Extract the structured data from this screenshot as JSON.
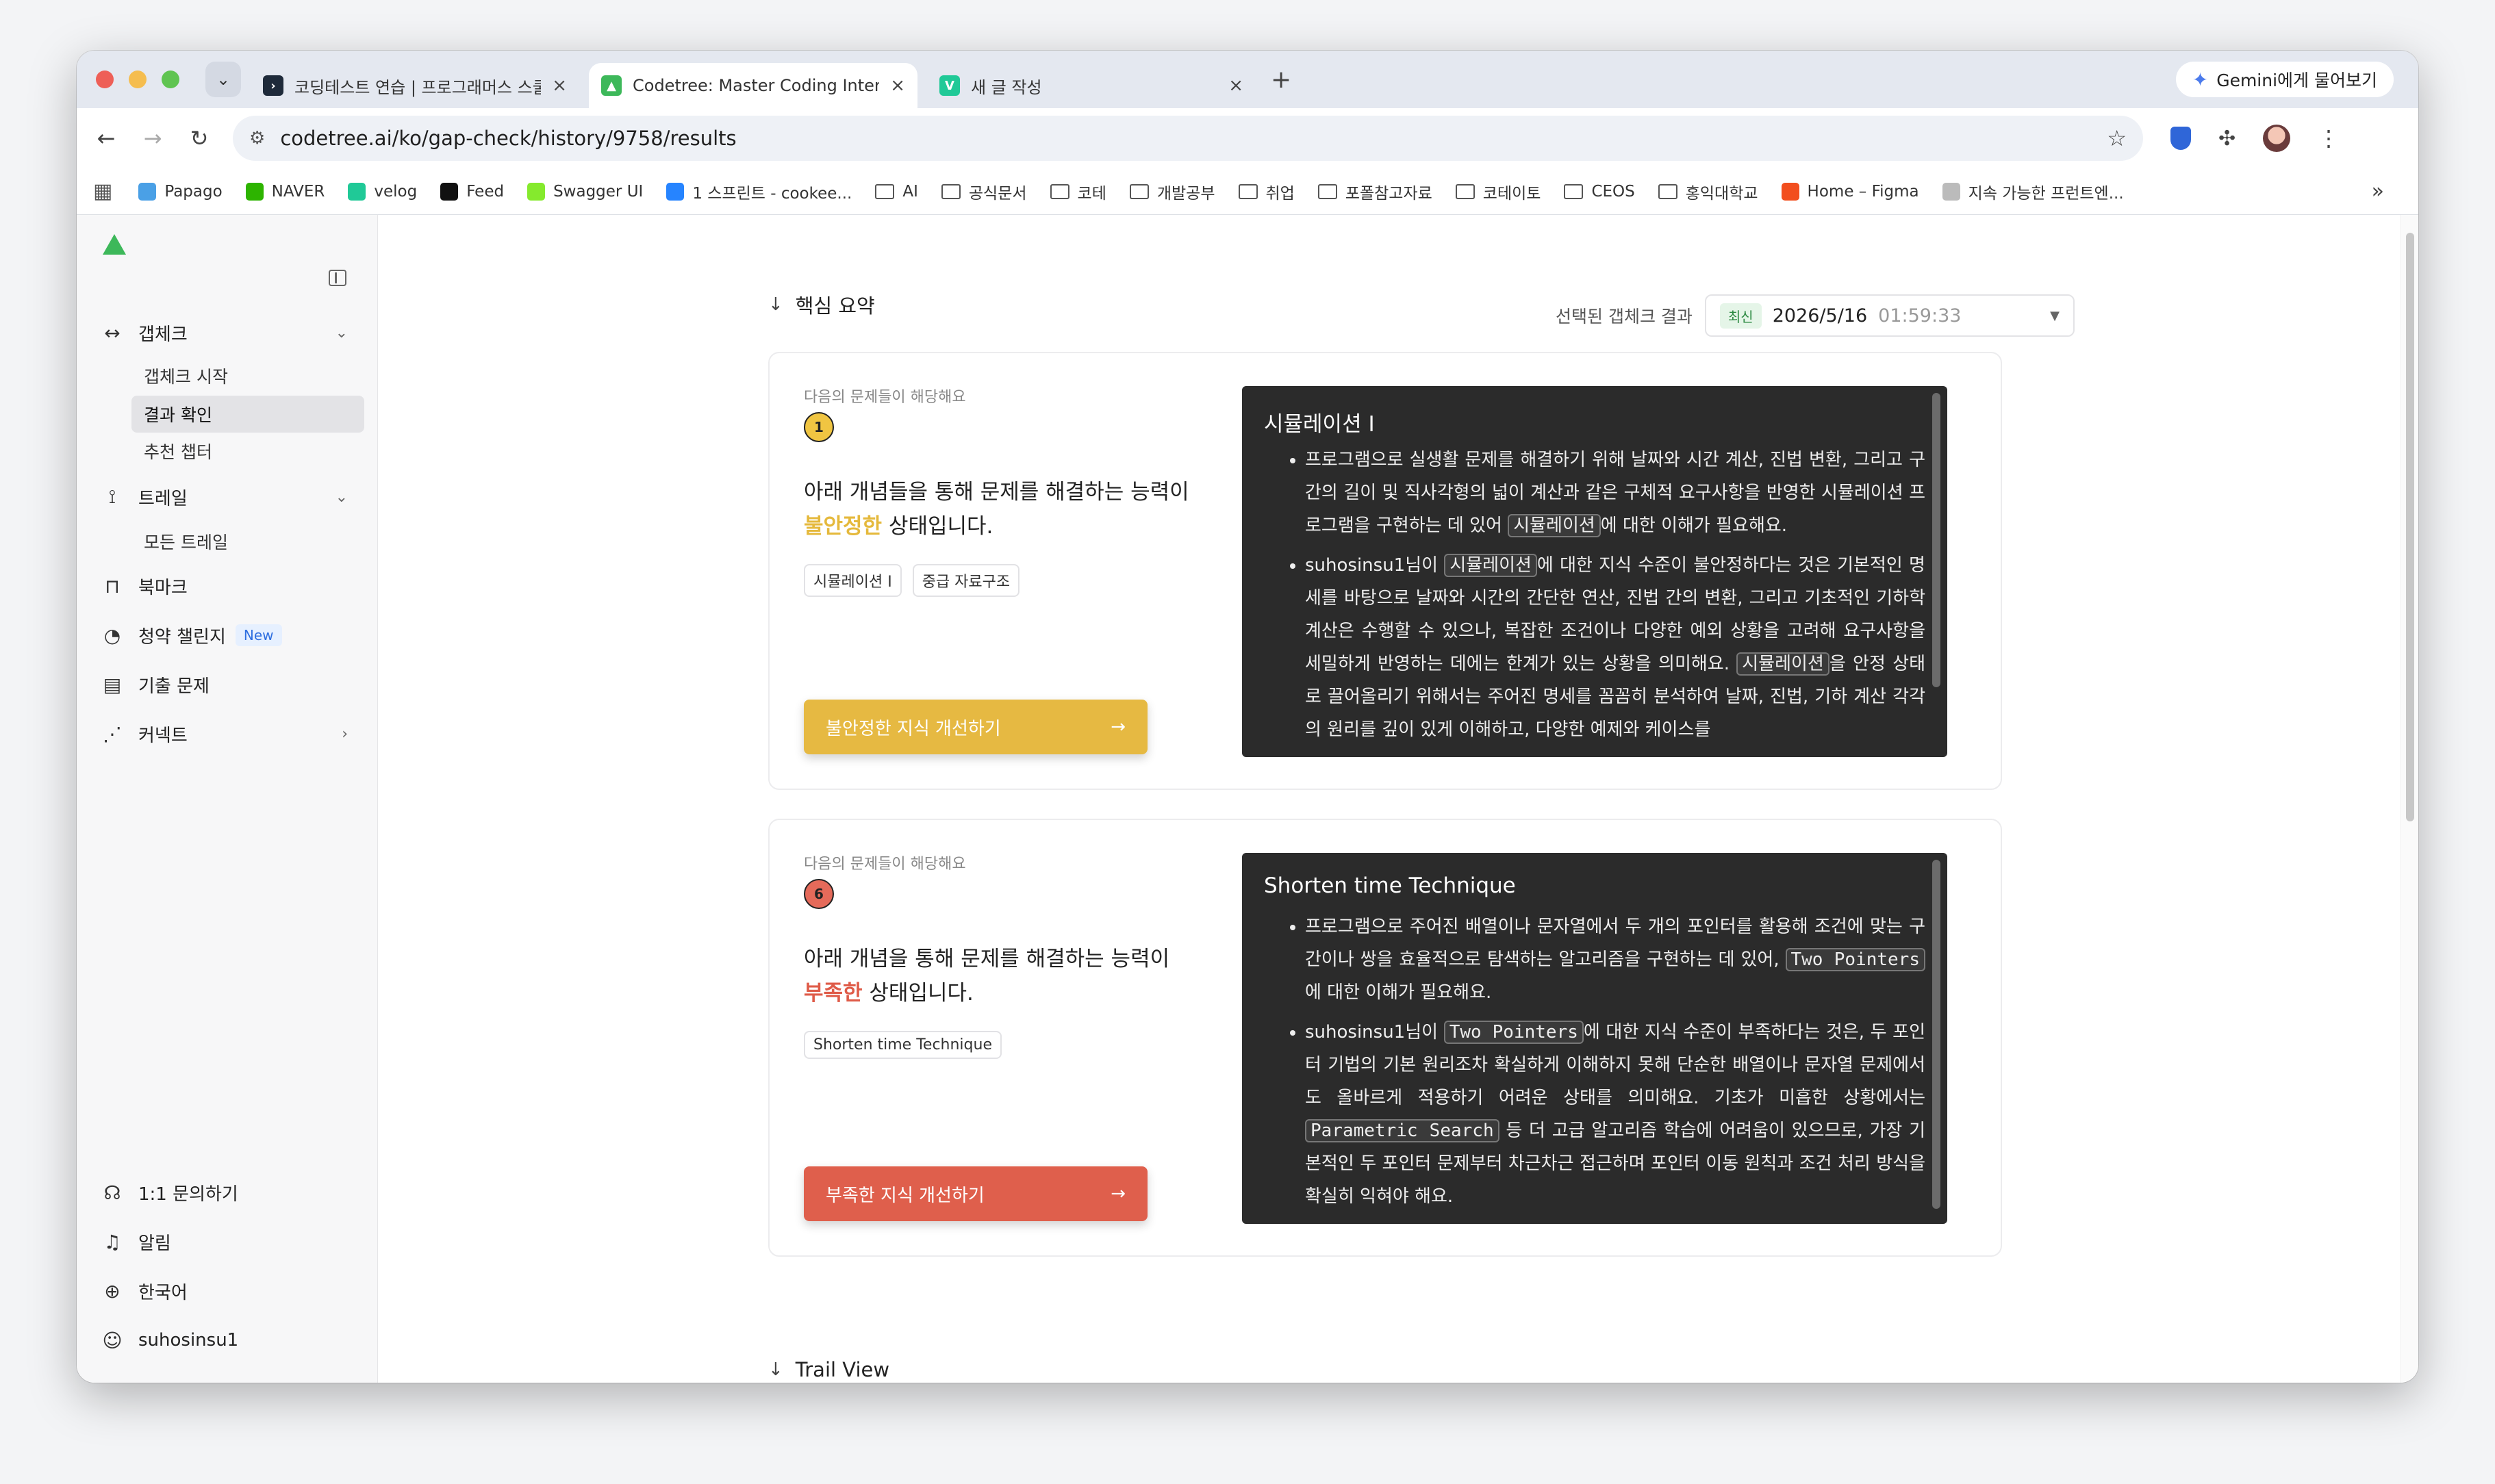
{
  "browser": {
    "tabs": [
      {
        "title": "코딩테스트 연습 | 프로그래머스 스쿨",
        "favicon": "programmers-icon",
        "active": false
      },
      {
        "title": "Codetree: Master Coding Interview",
        "favicon": "codetree-icon",
        "active": true
      },
      {
        "title": "새 글 작성",
        "favicon": "velog-icon",
        "active": false
      }
    ],
    "gemini_label": "Gemini에게 물어보기",
    "url": "codetree.ai/ko/gap-check/history/9758/results",
    "bookmarks": [
      {
        "label": "Papago",
        "icon": "papago-icon",
        "color": "#4aa0e6"
      },
      {
        "label": "NAVER",
        "icon": "naver-icon",
        "color": "#2db400"
      },
      {
        "label": "velog",
        "icon": "velog-icon",
        "color": "#20c997"
      },
      {
        "label": "Feed",
        "icon": "github-icon",
        "color": "#111111"
      },
      {
        "label": "Swagger UI",
        "icon": "swagger-icon",
        "color": "#85ea2d"
      },
      {
        "label": "1 스프린트 - cookee...",
        "icon": "jira-icon",
        "color": "#2684ff"
      },
      {
        "label": "AI",
        "icon": "folder-icon"
      },
      {
        "label": "공식문서",
        "icon": "folder-icon"
      },
      {
        "label": "코테",
        "icon": "folder-icon"
      },
      {
        "label": "개발공부",
        "icon": "folder-icon"
      },
      {
        "label": "취업",
        "icon": "folder-icon"
      },
      {
        "label": "포폴참고자료",
        "icon": "folder-icon"
      },
      {
        "label": "코테이토",
        "icon": "folder-icon"
      },
      {
        "label": "CEOS",
        "icon": "folder-icon"
      },
      {
        "label": "홍익대학교",
        "icon": "folder-icon"
      },
      {
        "label": "Home – Figma",
        "icon": "figma-icon",
        "color": "#f24e1e"
      },
      {
        "label": "지속 가능한 프런트엔...",
        "icon": "page-icon",
        "color": "#bbbbbb"
      }
    ]
  },
  "sidebar": {
    "gapcheck": "갭체크",
    "gapcheck_start": "갭체크 시작",
    "result_check": "결과 확인",
    "recommended_chapter": "추천 챕터",
    "trail": "트레일",
    "all_trails": "모든 트레일",
    "bookmark": "북마크",
    "challenge": "청약 챌린지",
    "new_badge": "New",
    "past_problems": "기출 문제",
    "connect": "커넥트",
    "inquiry": "1:1 문의하기",
    "notifications": "알림",
    "language": "한국어",
    "username": "suhosinsu1"
  },
  "summary": {
    "header": "핵심 요약",
    "selected_label": "선택된 갭체크 결과",
    "latest_badge": "최신",
    "date": "2026/5/16",
    "time": "01:59:33"
  },
  "cards": [
    {
      "caption": "다음의 문제들이 해당해요",
      "count": "1",
      "badge_color": "#f0c542",
      "msg_pre": "아래 개념들을 통해 문제를 해결하는 능력이",
      "status": "불안정한",
      "msg_post": " 상태입니다.",
      "chips": [
        "시뮬레이션 I",
        "중급 자료구조"
      ],
      "cta": "불안정한 지식 개선하기",
      "cta_color": "#e6b942",
      "panel_title": "시뮬레이션 I",
      "p1_a": "프로그램으로 실생활 문제를 해결하기 위해 날짜와 시간 계산, 진법 변환, 그리고 구간의 길이 및 직사각형의 넓이 계산과 같은 구체적 요구사항을 반영한 시뮬레이션 프로그램을 구현하는 데 있어 ",
      "p1_code": "시뮬레이션",
      "p1_b": "에 대한 이해가 필요해요.",
      "p2_a": "suhosinsu1님이 ",
      "p2_code1": "시뮬레이션",
      "p2_b": "에 대한 지식 수준이 불안정하다는 것은 기본적인 명세를 바탕으로 날짜와 시간의 간단한 연산, 진법 간의 변환, 그리고 기초적인 기하학 계산은 수행할 수 있으나, 복잡한 조건이나 다양한 예외 상황을 고려해 요구사항을 세밀하게 반영하는 데에는 한계가 있는 상황을 의미해요. ",
      "p2_code2": "시뮬레이션",
      "p2_c": "을 안정 상태로 끌어올리기 위해서는 주어진 명세를 꼼꼼히 분석하여 날짜, 진법, 기하 계산 각각의 원리를 깊이 있게 이해하고, 다양한 예제와 케이스를"
    },
    {
      "caption": "다음의 문제들이 해당해요",
      "count": "6",
      "badge_color": "#e56a5a",
      "msg_pre": "아래 개념을 통해 문제를 해결하는 능력이",
      "status": "부족한",
      "msg_post": " 상태입니다.",
      "chips": [
        "Shorten time Technique"
      ],
      "cta": "부족한 지식 개선하기",
      "cta_color": "#df5f4c",
      "panel_title": "Shorten time Technique",
      "p1_a": "프로그램으로 주어진 배열이나 문자열에서 두 개의 포인터를 활용해 조건에 맞는 구간이나 쌍을 효율적으로 탐색하는 알고리즘을 구현하는 데 있어, ",
      "p1_code": "Two Pointers",
      "p1_b": "에 대한 이해가 필요해요.",
      "p2_a": "suhosinsu1님이 ",
      "p2_code1": "Two Pointers",
      "p2_b": "에 대한 지식 수준이 부족하다는 것은, 두 포인터 기법의 기본 원리조차 확실하게 이해하지 못해 단순한 배열이나 문자열 문제에서도 올바르게 적용하기 어려운 상태를 의미해요. 기초가 미흡한 상황에서는 ",
      "p2_code2": "Parametric Search",
      "p2_c": " 등 더 고급 알고리즘 학습에 어려움이 있으므로, 가장 기본적인 두 포인터 문제부터 차근차근 접근하며 포인터 이동 원칙과 조건 처리 방식을 확실히 익혀야 해요."
    }
  ],
  "trail": {
    "header": "Trail View"
  }
}
